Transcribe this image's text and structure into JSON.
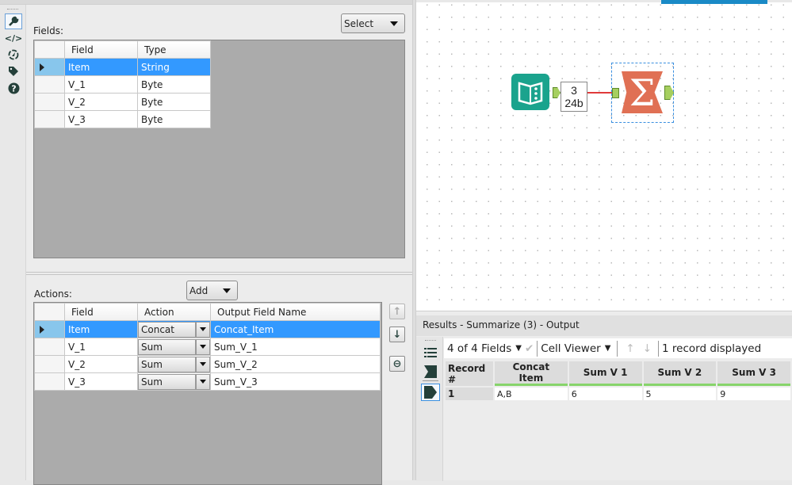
{
  "left_rail": {
    "icons": [
      "wrench-icon",
      "code-icon",
      "compass-icon",
      "tag-icon",
      "help-icon"
    ]
  },
  "fields_section": {
    "label": "Fields:",
    "select_button": "Select",
    "columns": [
      "Field",
      "Type"
    ],
    "rows": [
      {
        "field": "Item",
        "type": "String",
        "selected": true
      },
      {
        "field": "V_1",
        "type": "Byte"
      },
      {
        "field": "V_2",
        "type": "Byte"
      },
      {
        "field": "V_3",
        "type": "Byte"
      }
    ]
  },
  "actions_section": {
    "label": "Actions:",
    "add_button": "Add",
    "columns": [
      "Field",
      "Action",
      "Output Field Name"
    ],
    "rows": [
      {
        "field": "Item",
        "action": "Concat",
        "output": "Concat_Item",
        "selected": true
      },
      {
        "field": "V_1",
        "action": "Sum",
        "output": "Sum_V_1"
      },
      {
        "field": "V_2",
        "action": "Sum",
        "output": "Sum_V_2"
      },
      {
        "field": "V_3",
        "action": "Sum",
        "output": "Sum_V_3"
      }
    ],
    "side_buttons": [
      "move-up",
      "move-down",
      "remove"
    ]
  },
  "canvas": {
    "connection_count": "3",
    "connection_size": "24b",
    "summarize_symbol": "Σ",
    "colors": {
      "input_tool": "#1aa38d",
      "summarize_tool": "#e07054",
      "connection": "#e03a3a",
      "accent": "#1a8ac6"
    }
  },
  "results": {
    "title": "Results - Summarize (3) - Output",
    "fields_selector": "4 of 4 Fields",
    "viewer_selector": "Cell Viewer",
    "record_status": "1 record displayed",
    "columns": [
      "Record #",
      "Concat Item",
      "Sum V 1",
      "Sum V 2",
      "Sum V 3"
    ],
    "rows": [
      {
        "record": "1",
        "values": [
          "A,B",
          "6",
          "5",
          "9"
        ]
      }
    ]
  }
}
